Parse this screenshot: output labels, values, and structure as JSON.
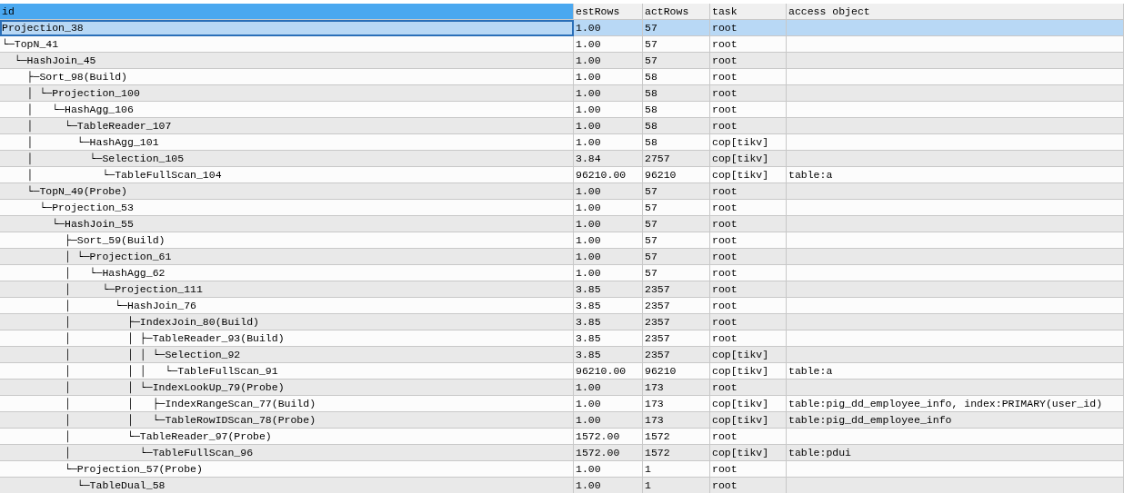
{
  "table": {
    "columns": [
      {
        "label": "id",
        "selected": true
      },
      {
        "label": "estRows",
        "selected": false
      },
      {
        "label": "actRows",
        "selected": false
      },
      {
        "label": "task",
        "selected": false
      },
      {
        "label": "access object",
        "selected": false
      }
    ],
    "rows": [
      {
        "selected": true,
        "cells": [
          "Projection_38",
          "1.00",
          "57",
          "root",
          ""
        ]
      },
      {
        "selected": false,
        "cells": [
          "└─TopN_41",
          "1.00",
          "57",
          "root",
          ""
        ]
      },
      {
        "selected": false,
        "cells": [
          "  └─HashJoin_45",
          "1.00",
          "57",
          "root",
          ""
        ]
      },
      {
        "selected": false,
        "cells": [
          "    ├─Sort_98(Build)",
          "1.00",
          "58",
          "root",
          ""
        ]
      },
      {
        "selected": false,
        "cells": [
          "    │ └─Projection_100",
          "1.00",
          "58",
          "root",
          ""
        ]
      },
      {
        "selected": false,
        "cells": [
          "    │   └─HashAgg_106",
          "1.00",
          "58",
          "root",
          ""
        ]
      },
      {
        "selected": false,
        "cells": [
          "    │     └─TableReader_107",
          "1.00",
          "58",
          "root",
          ""
        ]
      },
      {
        "selected": false,
        "cells": [
          "    │       └─HashAgg_101",
          "1.00",
          "58",
          "cop[tikv]",
          ""
        ]
      },
      {
        "selected": false,
        "cells": [
          "    │         └─Selection_105",
          "3.84",
          "2757",
          "cop[tikv]",
          ""
        ]
      },
      {
        "selected": false,
        "cells": [
          "    │           └─TableFullScan_104",
          "96210.00",
          "96210",
          "cop[tikv]",
          "table:a"
        ]
      },
      {
        "selected": false,
        "cells": [
          "    └─TopN_49(Probe)",
          "1.00",
          "57",
          "root",
          ""
        ]
      },
      {
        "selected": false,
        "cells": [
          "      └─Projection_53",
          "1.00",
          "57",
          "root",
          ""
        ]
      },
      {
        "selected": false,
        "cells": [
          "        └─HashJoin_55",
          "1.00",
          "57",
          "root",
          ""
        ]
      },
      {
        "selected": false,
        "cells": [
          "          ├─Sort_59(Build)",
          "1.00",
          "57",
          "root",
          ""
        ]
      },
      {
        "selected": false,
        "cells": [
          "          │ └─Projection_61",
          "1.00",
          "57",
          "root",
          ""
        ]
      },
      {
        "selected": false,
        "cells": [
          "          │   └─HashAgg_62",
          "1.00",
          "57",
          "root",
          ""
        ]
      },
      {
        "selected": false,
        "cells": [
          "          │     └─Projection_111",
          "3.85",
          "2357",
          "root",
          ""
        ]
      },
      {
        "selected": false,
        "cells": [
          "          │       └─HashJoin_76",
          "3.85",
          "2357",
          "root",
          ""
        ]
      },
      {
        "selected": false,
        "cells": [
          "          │         ├─IndexJoin_80(Build)",
          "3.85",
          "2357",
          "root",
          ""
        ]
      },
      {
        "selected": false,
        "cells": [
          "          │         │ ├─TableReader_93(Build)",
          "3.85",
          "2357",
          "root",
          ""
        ]
      },
      {
        "selected": false,
        "cells": [
          "          │         │ │ └─Selection_92",
          "3.85",
          "2357",
          "cop[tikv]",
          ""
        ]
      },
      {
        "selected": false,
        "cells": [
          "          │         │ │   └─TableFullScan_91",
          "96210.00",
          "96210",
          "cop[tikv]",
          "table:a"
        ]
      },
      {
        "selected": false,
        "cells": [
          "          │         │ └─IndexLookUp_79(Probe)",
          "1.00",
          "173",
          "root",
          ""
        ]
      },
      {
        "selected": false,
        "cells": [
          "          │         │   ├─IndexRangeScan_77(Build)",
          "1.00",
          "173",
          "cop[tikv]",
          "table:pig_dd_employee_info, index:PRIMARY(user_id)"
        ]
      },
      {
        "selected": false,
        "cells": [
          "          │         │   └─TableRowIDScan_78(Probe)",
          "1.00",
          "173",
          "cop[tikv]",
          "table:pig_dd_employee_info"
        ]
      },
      {
        "selected": false,
        "cells": [
          "          │         └─TableReader_97(Probe)",
          "1572.00",
          "1572",
          "root",
          ""
        ]
      },
      {
        "selected": false,
        "cells": [
          "          │           └─TableFullScan_96",
          "1572.00",
          "1572",
          "cop[tikv]",
          "table:pdui"
        ]
      },
      {
        "selected": false,
        "cells": [
          "          └─Projection_57(Probe)",
          "1.00",
          "1",
          "root",
          ""
        ]
      },
      {
        "selected": false,
        "cells": [
          "            └─TableDual_58",
          "1.00",
          "1",
          "root",
          ""
        ]
      }
    ]
  }
}
